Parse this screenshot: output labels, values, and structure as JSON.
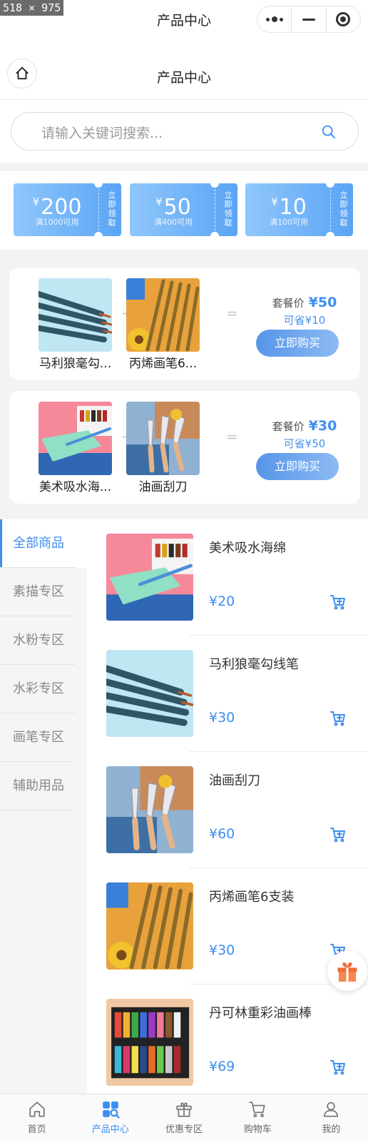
{
  "size_badge": "518 × 975",
  "topbar": {
    "title": "产品中心"
  },
  "navbar": {
    "title": "产品中心"
  },
  "search": {
    "placeholder": "请输入关键词搜索..."
  },
  "coupons": [
    {
      "currency": "¥",
      "amount": "200",
      "condition": "满1000可用",
      "action": "立即领取"
    },
    {
      "currency": "¥",
      "amount": "50",
      "condition": "满400可用",
      "action": "立即领取"
    },
    {
      "currency": "¥",
      "amount": "10",
      "condition": "满100可用",
      "action": "立即领取"
    }
  ],
  "combos": [
    {
      "items": [
        "马利狼毫勾...",
        "丙烯画笔6..."
      ],
      "price_label": "套餐价",
      "price": "¥50",
      "saving": "可省¥10",
      "buy_label": "立即购买"
    },
    {
      "items": [
        "美术吸水海...",
        "油画刮刀"
      ],
      "price_label": "套餐价",
      "price": "¥30",
      "saving": "可省¥50",
      "buy_label": "立即购买"
    }
  ],
  "categories": [
    "全部商品",
    "素描专区",
    "水粉专区",
    "水彩专区",
    "画笔专区",
    "辅助用品"
  ],
  "active_category": "全部商品",
  "products": [
    {
      "name": "美术吸水海绵",
      "price": "¥20"
    },
    {
      "name": "马利狼毫勾线笔",
      "price": "¥30"
    },
    {
      "name": "油画刮刀",
      "price": "¥60"
    },
    {
      "name": "丙烯画笔6支装",
      "price": "¥30"
    },
    {
      "name": "丹可林重彩油画棒",
      "price": "¥69"
    }
  ],
  "tabbar": [
    {
      "label": "首页",
      "icon": "home-icon"
    },
    {
      "label": "产品中心",
      "icon": "grid-search-icon",
      "active": true
    },
    {
      "label": "优惠专区",
      "icon": "gift-icon"
    },
    {
      "label": "购物车",
      "icon": "cart-icon"
    },
    {
      "label": "我的",
      "icon": "user-icon"
    }
  ],
  "colors": {
    "accent": "#3d8ef0",
    "coupon_start": "#8fc7fb",
    "coupon_end": "#5aa4f5",
    "gift": "#f06a3a"
  }
}
